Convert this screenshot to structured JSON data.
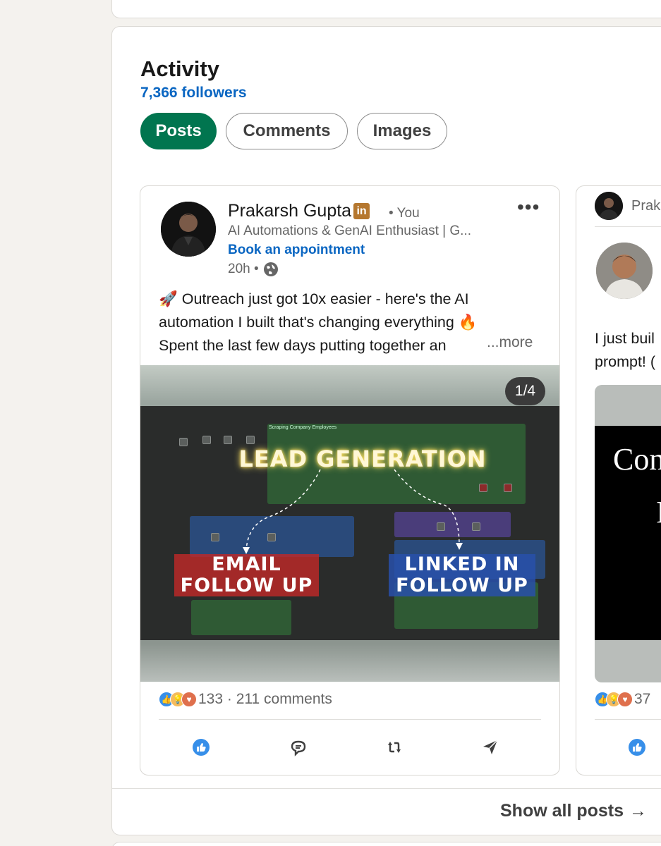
{
  "activity": {
    "title": "Activity",
    "followers": "7,366 followers",
    "tabs": [
      {
        "label": "Posts",
        "active": true
      },
      {
        "label": "Comments",
        "active": false
      },
      {
        "label": "Images",
        "active": false
      }
    ],
    "show_all": "Show all posts",
    "show_all_arrow": "→"
  },
  "post1": {
    "author": "Prakarsh Gupta",
    "badge": "in",
    "you_tag": "• You",
    "headline": "AI Automations & GenAI Enthusiast | G...",
    "book_link": "Book an appointment",
    "time": "20h •",
    "text_lines": [
      "🚀 Outreach just got 10x easier - here's the AI",
      "automation I built that's changing everything 🔥",
      "Spent the last few days putting together an"
    ],
    "see_more": "...more",
    "media": {
      "counter": "1/4",
      "headline": "LEAD GENERATION",
      "left_label_1": "EMAIL",
      "left_label_2": "FOLLOW UP",
      "right_label_1": "LINKED IN",
      "right_label_2": "FOLLOW UP",
      "panel_title": "Scraping Company Employees"
    },
    "reactions": "133 · 211 comments",
    "colors": {
      "accent": "#0a66c2",
      "active_tab": "#01754f",
      "badge": "#b5772f"
    }
  },
  "post2": {
    "author": "Prak",
    "text_lines": [
      "I just buil",
      "prompt! ("
    ],
    "media_text_1": "Con",
    "media_text_2": "I",
    "reactions": "37"
  }
}
